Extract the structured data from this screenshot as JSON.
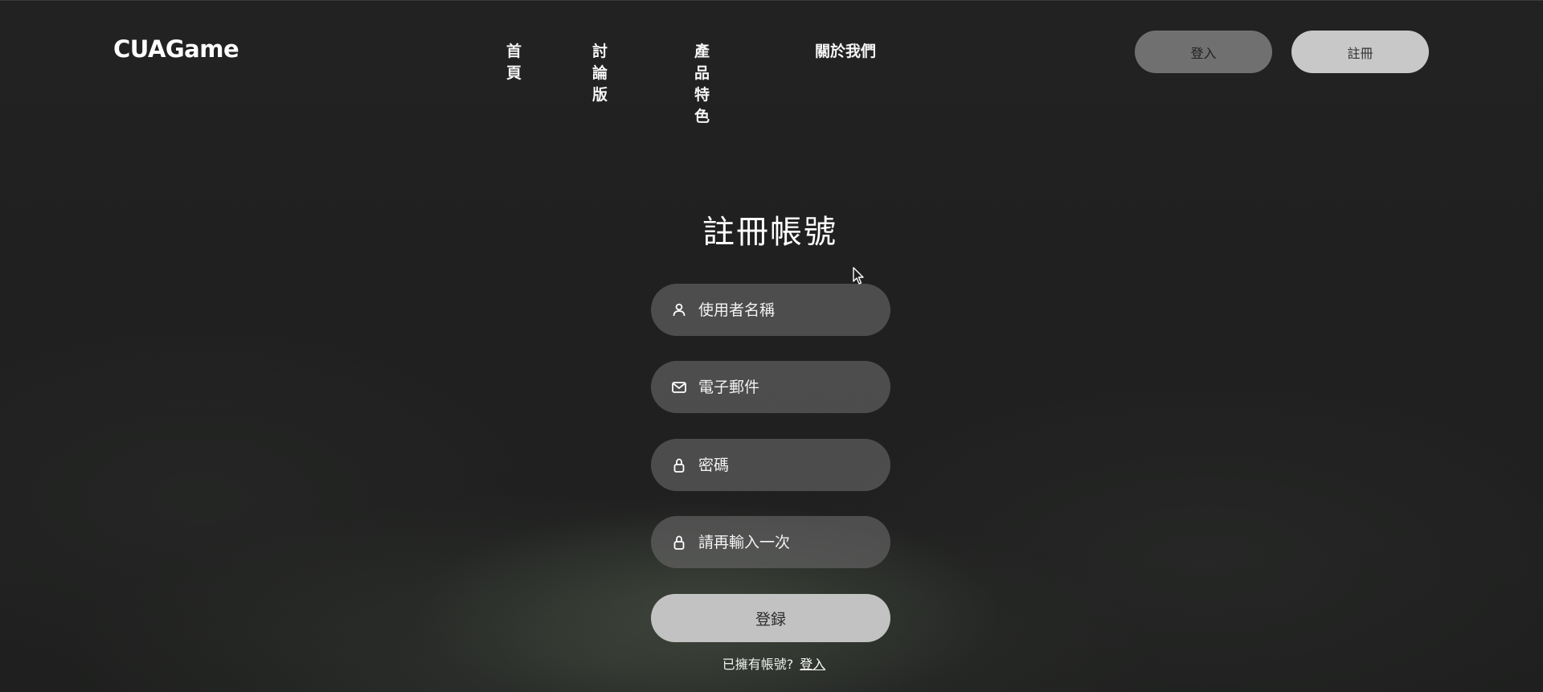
{
  "header": {
    "brand": "CUAGame",
    "nav": [
      "首頁",
      "討論版",
      "產品特色",
      "關於我們"
    ],
    "login_label": "登入",
    "register_label": "註冊"
  },
  "form": {
    "title": "註冊帳號",
    "fields": [
      {
        "icon": "user-icon",
        "placeholder": "使用者名稱"
      },
      {
        "icon": "mail-icon",
        "placeholder": "電子郵件"
      },
      {
        "icon": "lock-icon",
        "placeholder": "密碼"
      },
      {
        "icon": "lock-icon",
        "placeholder": "請再輸入一次"
      }
    ],
    "submit_label": "登録",
    "have_account_text": "已擁有帳號?",
    "login_link": "登入"
  },
  "colors": {
    "background": "#202020",
    "field_bg": "#5f5f5f",
    "login_btn": "#707070",
    "register_btn": "#c8c8c8",
    "submit_btn": "#c2c2c2"
  }
}
